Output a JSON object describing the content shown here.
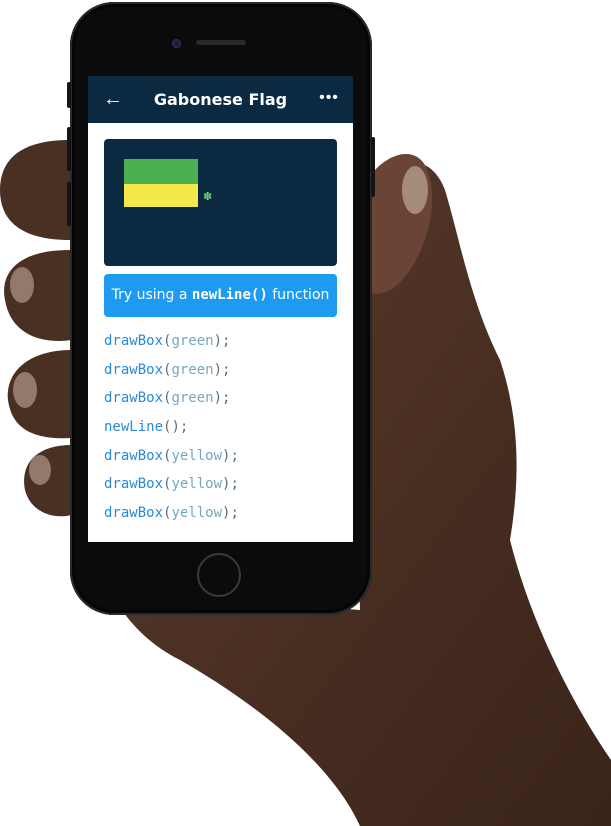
{
  "screen": {
    "title": "Gabonese Flag",
    "back_icon": "arrow-left-icon",
    "more_icon": "more-icon"
  },
  "canvas": {
    "colors": {
      "background": "#0b2a42",
      "green": "#4caf50",
      "yellow": "#f4e84a",
      "bug": "#6dd66d"
    },
    "bug_icon": "bug-icon"
  },
  "hint": {
    "prefix": "Try using a ",
    "code": "newLine()",
    "suffix": " function"
  },
  "code": [
    {
      "fn": "drawBox",
      "open": "(",
      "arg": "green",
      "close": ");"
    },
    {
      "fn": "drawBox",
      "open": "(",
      "arg": "green",
      "close": ");"
    },
    {
      "fn": "drawBox",
      "open": "(",
      "arg": "green",
      "close": ");"
    },
    {
      "fn": "newLine",
      "open": "(",
      "arg": "",
      "close": ");"
    },
    {
      "fn": "drawBox",
      "open": "(",
      "arg": "yellow",
      "close": ");"
    },
    {
      "fn": "drawBox",
      "open": "(",
      "arg": "yellow",
      "close": ");"
    },
    {
      "fn": "drawBox",
      "open": "(",
      "arg": "yellow",
      "close": ");"
    }
  ],
  "theme": {
    "header": "#0b2a42",
    "accent": "#1e9bf0",
    "code_fn": "#2a89d8",
    "code_arg": "#74a7bf"
  }
}
